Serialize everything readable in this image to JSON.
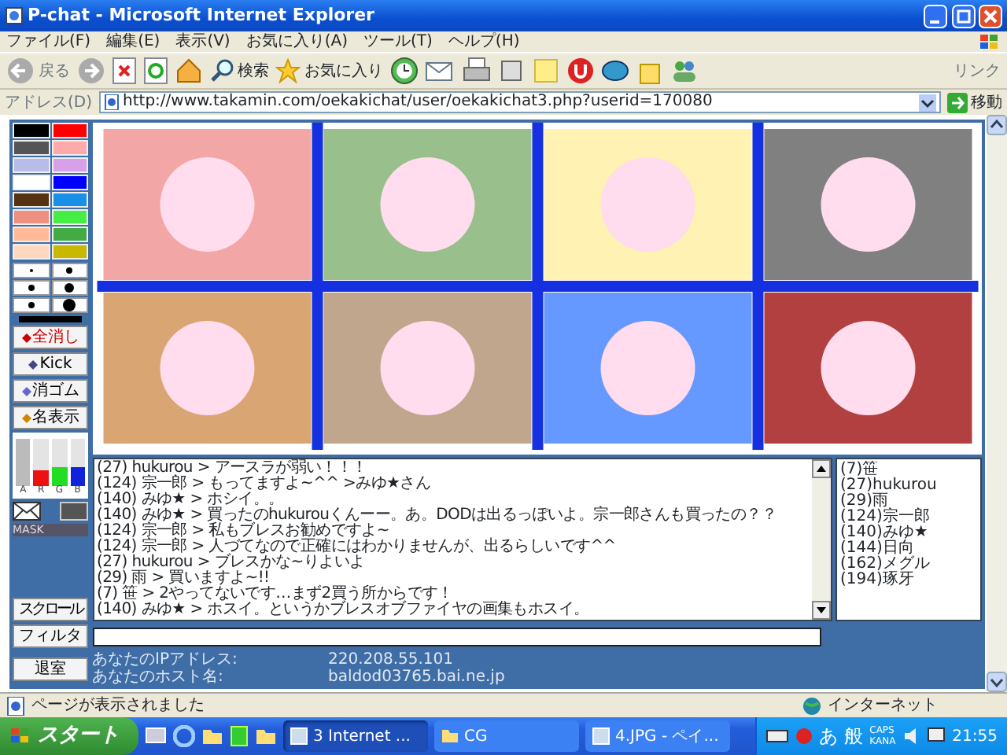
{
  "window": {
    "title": "P-chat - Microsoft Internet Explorer"
  },
  "menu": [
    "ファイル(F)",
    "編集(E)",
    "表示(V)",
    "お気に入り(A)",
    "ツール(T)",
    "ヘルプ(H)"
  ],
  "toolbar": {
    "back": "戻る",
    "search": "検索",
    "favorites": "お気に入り",
    "links": "リンク"
  },
  "address_bar": {
    "label": "アドレス(D)",
    "url": "http://www.takamin.com/oekakichat/user/oekakichat3.php?userid=170080",
    "go": "移動"
  },
  "chat": {
    "palette": [
      {
        "color": "#000000"
      },
      {
        "color": "#ff0000"
      },
      {
        "color": "#555555"
      },
      {
        "color": "#ffaaaa"
      },
      {
        "color": "#b8bce8"
      },
      {
        "color": "#d8a0e8"
      },
      {
        "color": "#ffffff"
      },
      {
        "color": "#0000ff"
      },
      {
        "color": "#553311"
      },
      {
        "color": "#1890e8"
      },
      {
        "color": "#ee9080"
      },
      {
        "color": "#44ee44"
      },
      {
        "color": "#ffbb99"
      },
      {
        "color": "#44aa44"
      },
      {
        "color": "#ffd8c0"
      },
      {
        "color": "#c8b800"
      }
    ],
    "tools": [
      "全消し",
      "Kick",
      "消ゴム",
      "名表示"
    ],
    "channels": [
      {
        "label": "A",
        "level": 1.0
      },
      {
        "label": "R",
        "level": 0.35
      },
      {
        "label": "G",
        "level": 0.4
      },
      {
        "label": "B",
        "level": 0.4
      }
    ],
    "mask_label": "MASK",
    "scroll_button": "スクロール",
    "messages": [
      "(27) hukurou > アースラが弱い！！！",
      "(124) 宗一郎 > もってますよ~^^ >みゆ★さん",
      "(140) みゆ★ > ホシイ。。",
      "(140) みゆ★ > 買ったのhukurouくんーー。あ。DODは出るっぽいよ。宗一郎さんも買ったの？？",
      "(124) 宗一郎 > 私もブレスお勧めですよ~",
      "(124) 宗一郎 > 人づてなので正確にはわかりませんが、出るらしいです^^",
      "(27) hukurou > ブレスかな~りよいよ",
      "(29) 雨 > 買いますよ~!!",
      "(7) 笹 > 2やってないです…まず2買う所からです！",
      "(140) みゆ★ > ホスイ。というかブレスオブファイヤの画集もホスイ。"
    ],
    "users": [
      "(7)笹",
      "(27)hukurou",
      "(29)雨",
      "(124)宗一郎",
      "(140)みゆ★",
      "(144)日向",
      "(162)メグル",
      "(194)琢牙"
    ],
    "filter_button": "フィルタ",
    "exit_button": "退室",
    "info": [
      {
        "label": "あなたのIPアドレス:",
        "value": "220.208.55.101"
      },
      {
        "label": "あなたのホスト名:",
        "value": "baldod03765.bai.ne.jp"
      }
    ]
  },
  "status_bar": {
    "text": "ページが表示されました",
    "zone": "インターネット"
  },
  "taskbar": {
    "start": "スタート",
    "tasks": [
      {
        "label": "3 Internet ...",
        "selected": true
      },
      {
        "label": "CG",
        "selected": false
      },
      {
        "label": "4.JPG - ペイ...",
        "selected": false
      }
    ],
    "ime": [
      "あ",
      "般"
    ],
    "caps": "CAPS",
    "kana": "KANA",
    "clock": "21:55"
  }
}
